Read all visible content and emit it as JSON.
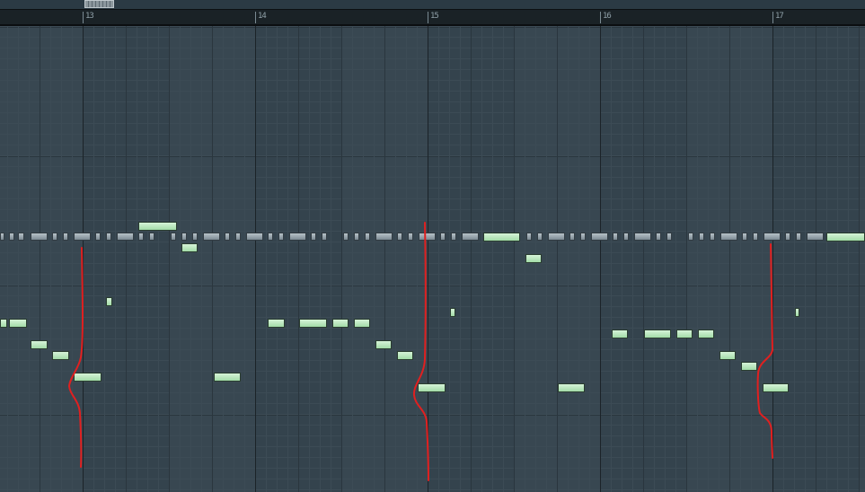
{
  "ruler": {
    "bars": [
      {
        "label": "13",
        "name": "bar-13"
      },
      {
        "label": "14",
        "name": "bar-14"
      },
      {
        "label": "15",
        "name": "bar-15"
      },
      {
        "label": "16",
        "name": "bar-16"
      },
      {
        "label": "17",
        "name": "bar-17"
      }
    ]
  },
  "colors": {
    "background": "#34434d",
    "grid_line": "#3c4b55",
    "beat_line": "#2a363e",
    "bar_line": "#1b2328",
    "note_fill": "#b9e8bd",
    "note_border": "#2a3d30",
    "control_note": "#9aa6ad",
    "annotation_stroke": "#e02020"
  },
  "annotations": {
    "count": 3,
    "type": "red freehand curve"
  }
}
